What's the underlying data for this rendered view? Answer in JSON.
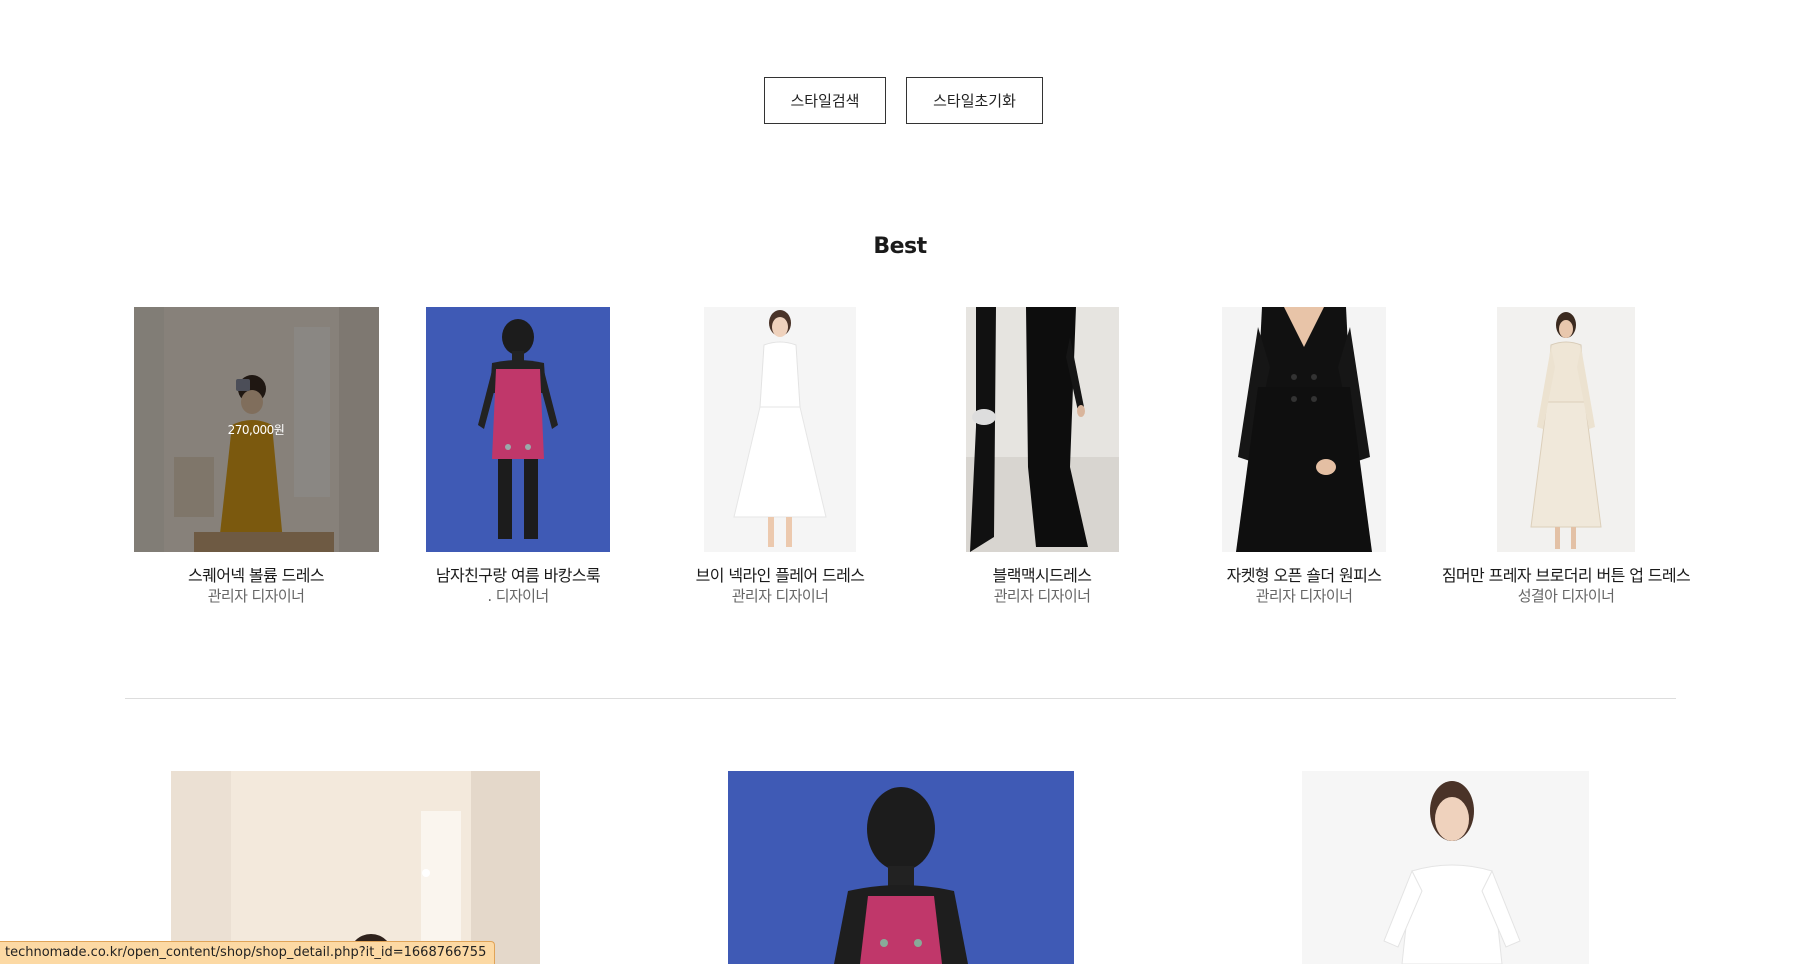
{
  "search": {
    "search_button": "스타일검색",
    "reset_button": "스타일초기화"
  },
  "best": {
    "title": "Best",
    "items": [
      {
        "name": "스퀘어넥 볼륨 드레스",
        "designer": "관리자 디자이너",
        "price": "270,000원"
      },
      {
        "name": "남자친구랑 여름 바캉스룩",
        "designer": ". 디자이너"
      },
      {
        "name": "브이 넥라인 플레어 드레스",
        "designer": "관리자 디자이너"
      },
      {
        "name": "블랙맥시드레스",
        "designer": "관리자 디자이너"
      },
      {
        "name": "자켓형 오픈 숄더 원피스",
        "designer": "관리자 디자이너"
      },
      {
        "name": "짐머만 프레자 브로더리 버튼 업 드레스",
        "designer": "성결아 디자이너"
      }
    ]
  },
  "status_bar": {
    "url": "technomade.co.kr/open_content/shop/shop_detail.php?it_id=1668766755"
  },
  "colors": {
    "avatar_blue": "#3f5ab5",
    "dress_pink": "#c0376a",
    "overlay": "#00000073",
    "status_bg": "#fcd9a4"
  }
}
